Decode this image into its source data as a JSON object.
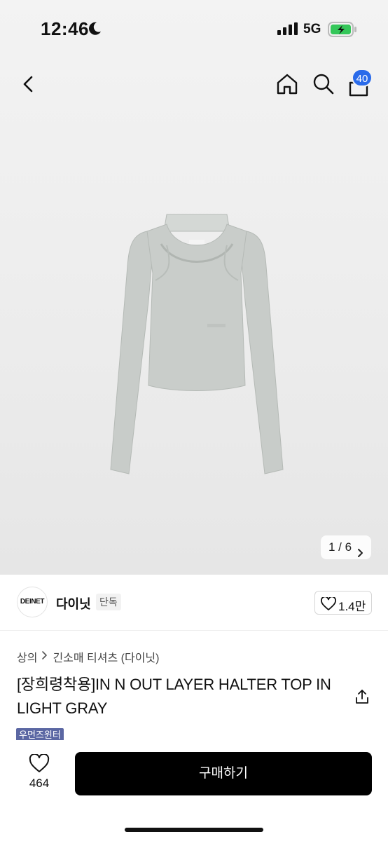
{
  "status_bar": {
    "time": "12:46",
    "network": "5G",
    "moon_icon": "moon-icon",
    "battery_icon": "battery-charging-icon"
  },
  "nav": {
    "back_icon": "chevron-left-icon",
    "home_icon": "home-icon",
    "search_icon": "search-icon",
    "cart_icon": "cart-icon",
    "cart_badge": "40",
    "badge_color": "#2a6bea"
  },
  "gallery": {
    "current": "1",
    "separator": "/",
    "total": "6",
    "pager_text": "1 / 6"
  },
  "brand": {
    "logo_text": "DEINET",
    "name": "다이닛",
    "tag": "단독",
    "like_count": "1.4만"
  },
  "product": {
    "breadcrumb": [
      "상의",
      "긴소매 티셔츠 (다이닛)"
    ],
    "title": "[장희령착용]IN N OUT LAYER HALTER TOP IN LIGHT GRAY",
    "badge": "우먼즈윈터",
    "badge_color": "#5b67a3"
  },
  "bottom_bar": {
    "favorite_count": "464",
    "buy_label": "구매하기",
    "buy_color": "#000000"
  }
}
